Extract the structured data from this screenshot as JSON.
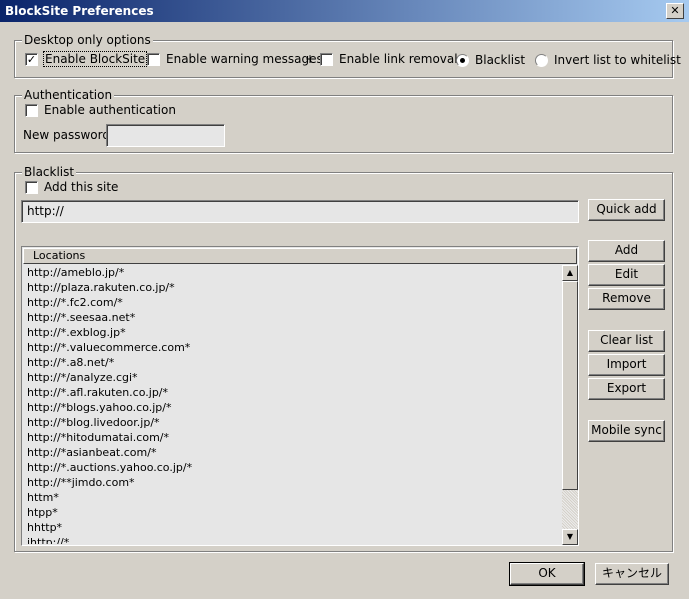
{
  "window": {
    "title": "BlockSite Preferences",
    "close_glyph": "✕"
  },
  "desktop": {
    "legend": "Desktop only options",
    "enable_blocksite": "Enable BlockSite",
    "enable_warning": "Enable warning messages",
    "plus": "+",
    "enable_link_removal": "Enable link removal",
    "blacklist_radio": "Blacklist",
    "whitelist_radio": "Invert list to whitelist"
  },
  "auth": {
    "legend": "Authentication",
    "enable_auth": "Enable authentication",
    "new_password_label": "New password",
    "new_password_value": ""
  },
  "blacklist": {
    "legend": "Blacklist",
    "add_this_site": "Add this site",
    "url_value": "http://",
    "quick_add": "Quick add",
    "column_header": "Locations",
    "locations": [
      "http://ameblo.jp/*",
      "http://plaza.rakuten.co.jp/*",
      "http://*.fc2.com/*",
      "http://*.seesaa.net*",
      "http://*.exblog.jp*",
      "http://*.valuecommerce.com*",
      "http://*.a8.net/*",
      "http://*/analyze.cgi*",
      "http://*.afl.rakuten.co.jp/*",
      "http://*blogs.yahoo.co.jp/*",
      "http://*blog.livedoor.jp/*",
      "http://*hitodumatai.com/*",
      "http://*asianbeat.com/*",
      "http://*.auctions.yahoo.co.jp/*",
      "http://**jimdo.com*",
      "httm*",
      "htpp*",
      "hhttp*",
      "ihttp://*"
    ],
    "buttons": {
      "add": "Add",
      "edit": "Edit",
      "remove": "Remove",
      "clear_list": "Clear list",
      "import": "Import",
      "export": "Export",
      "mobile_sync": "Mobile sync"
    }
  },
  "footer": {
    "ok": "OK",
    "cancel": "キャンセル"
  }
}
